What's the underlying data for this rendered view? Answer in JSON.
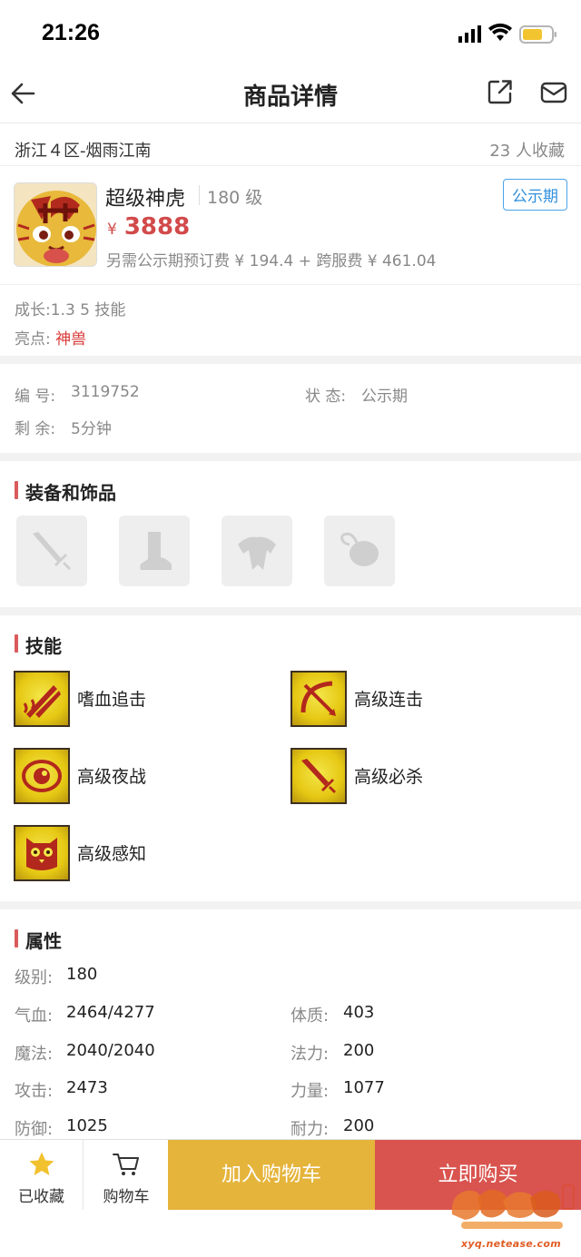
{
  "status_bar": {
    "time": "21:26"
  },
  "nav": {
    "title": "商品详情"
  },
  "server": {
    "name": "浙江４区-烟雨江南",
    "favorites": "23 人收藏"
  },
  "product": {
    "name": "超级神虎",
    "level": "180 级",
    "status_badge": "公示期",
    "currency": "¥",
    "price": "3888",
    "fee_note": "另需公示期预订费 ¥ 194.4 + 跨服费 ¥ 461.04"
  },
  "summary": {
    "growth": "成长:1.3 5 技能",
    "highlight_label": "亮点: ",
    "highlight_value": "神兽"
  },
  "info": {
    "id_label": "编  号:",
    "id_value": "3119752",
    "state_label": "状  态:",
    "state_value": "公示期",
    "remain_label": "剩  余:",
    "remain_value": "5分钟"
  },
  "equipment": {
    "title": "装备和饰品"
  },
  "skills": {
    "title": "技能",
    "items": [
      "嗜血追击",
      "高级连击",
      "高级夜战",
      "高级必杀",
      "高级感知"
    ]
  },
  "attributes": {
    "title": "属性",
    "level_label": "级别:",
    "level_value": "180",
    "rows": [
      {
        "l_label": "气血:",
        "l_value": "2464/4277",
        "r_label": "体质:",
        "r_value": "403"
      },
      {
        "l_label": "魔法:",
        "l_value": "2040/2040",
        "r_label": "法力:",
        "r_value": "200"
      },
      {
        "l_label": "攻击:",
        "l_value": "2473",
        "r_label": "力量:",
        "r_value": "1077"
      },
      {
        "l_label": "防御:",
        "l_value": "1025",
        "r_label": "耐力:",
        "r_value": "200"
      }
    ]
  },
  "bottom": {
    "fav_label": "已收藏",
    "cart_label": "购物车",
    "add_cart": "加入购物车",
    "buy_now": "立即购买"
  },
  "watermark": {
    "url": "xyq.netease.com"
  },
  "colors": {
    "price": "#d24a4a",
    "badge": "#2f8fdc",
    "add_cart": "#e5b43b",
    "buy_now": "#d9544f",
    "accent_bar": "#d95b5b"
  }
}
